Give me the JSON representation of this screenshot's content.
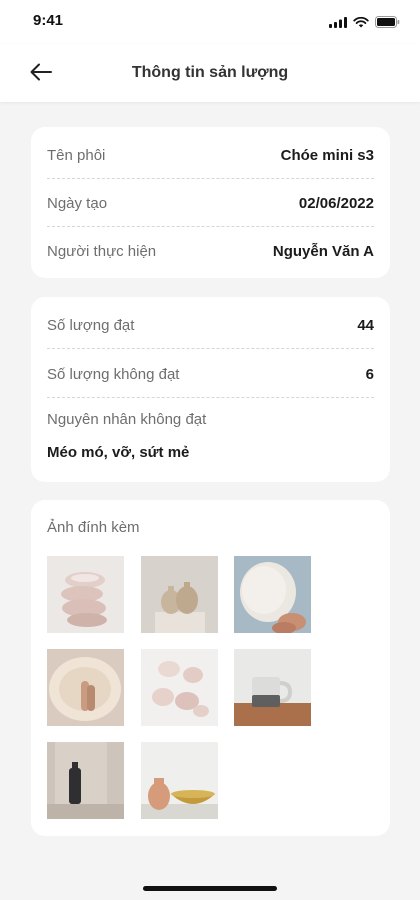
{
  "status_bar": {
    "time": "9:41"
  },
  "header": {
    "title": "Thông tin sản lượng"
  },
  "info": {
    "rows": [
      {
        "label": "Tên phôi",
        "value": "Chóe mini s3"
      },
      {
        "label": "Ngày tạo",
        "value": "02/06/2022"
      },
      {
        "label": "Người thực hiện",
        "value": "Nguyễn Văn A"
      }
    ]
  },
  "quantity": {
    "passed_label": "Số lượng đạt",
    "passed_value": "44",
    "failed_label": "Số lượng không đạt",
    "failed_value": "6",
    "reason_label": "Nguyên nhân không đạt",
    "reason_value": "Méo mó, vỡ, sứt mẻ"
  },
  "attachments": {
    "label": "Ảnh đính kèm",
    "photos": [
      "stacked-cups-photo",
      "vases-on-plinth-photo",
      "hands-shaping-vase-photo",
      "shaping-plate-photo",
      "scattered-cups-photo",
      "mug-on-table-photo",
      "dark-vase-niche-photo",
      "pot-and-bowl-photo"
    ]
  },
  "colors": {
    "background": "#f4f4f4",
    "card": "#ffffff",
    "label": "#6e6e6e",
    "value": "#1c1c1c"
  }
}
